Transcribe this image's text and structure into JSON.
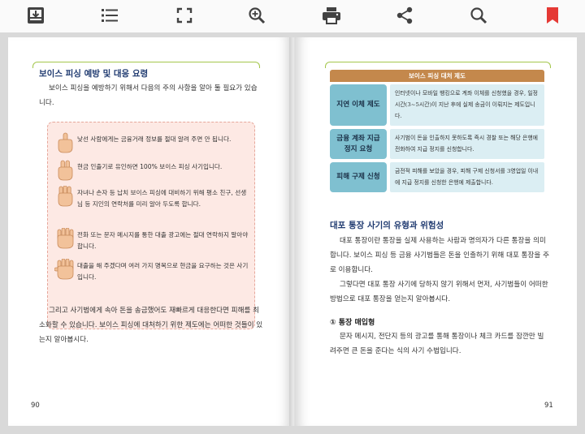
{
  "toolbar": {
    "icons": [
      "download-icon",
      "list-icon",
      "fullscreen-icon",
      "zoom-in-icon",
      "print-icon",
      "share-icon",
      "search-icon",
      "bookmark-icon"
    ],
    "bookmark_color": "#e53935",
    "icon_color": "#424242"
  },
  "left_page": {
    "section_title": "보이스 피싱 예방 및 대응 요령",
    "intro": "보이스 피싱을 예방하기 위해서 다음의 주의 사항을 알아 둘 필요가 있습니다.",
    "tips": [
      "낯선 사람에게는 금융거래 정보를 절대 알려 주면 안 됩니다.",
      "현금 인출기로 유인하면 100% 보이스 피싱 사기입니다.",
      "자녀나 손자 등 납치 보이스 피싱에 대비하기 위해 평소 친구, 선생님 등 지인의 연락처를 미리 알아 두도록 합니다.",
      "전화 또는 문자 메시지를 통한 대출 광고에는 절대 연락하지 말아야 합니다.",
      "대출을 해 주겠다며 여러 가지 명목으로 현금을 요구하는 것은 사기입니다."
    ],
    "closing": "그리고 사기범에게 속아 돈을 송금했어도 재빠르게 대응한다면 피해를 최소화할 수 있습니다. 보이스 피싱에 대처하기 위한 제도에는 어떠한 것들이 있는지 알아봅시다.",
    "page_number": "90"
  },
  "right_page": {
    "table_title": "보이스 피싱 대처 제도",
    "table_rows": [
      {
        "label": "지연 이체 제도",
        "desc": "인터넷이나 모바일 뱅킹으로 계좌 이체를 신청했을 경우, 일정 시간(3~5시간)이 지난 후에 실제 송금이 이뤄지는 제도입니다."
      },
      {
        "label": "금융 계좌 지급 정지 요청",
        "desc": "사기범이 돈을 인출하지 못하도록 즉시 경찰 또는 해당 은행에 전화하여 지급 정지를 신청합니다."
      },
      {
        "label": "피해 구제 신청",
        "desc": "금전적 피해를 보았을 경우, 피해 구제 신청서를 3영업일 이내에 지급 정지를 신청한 은행에 제출합니다."
      }
    ],
    "section_title": "대포 통장 사기의 유형과 위험성",
    "para1": "대포 통장이란 통장을 실제 사용하는 사람과 명의자가 다른 통장을 의미합니다. 보이스 피싱 등 금융 사기범들은 돈을 인출하기 위해 대포 통장을 주로 이용합니다.",
    "para2": "그렇다면 대포 통장 사기에 당하지 않기 위해서 먼저, 사기범들이 어떠한 방법으로 대포 통장을 얻는지 알아봅시다.",
    "sub_title": "① 통장 매입형",
    "para3": "문자 메시지, 전단지 등의 광고를 통해 통장이나 체크 카드를 잠깐만 빌려주면 큰 돈을 준다는 식의 사기 수법입니다.",
    "page_number": "91"
  }
}
